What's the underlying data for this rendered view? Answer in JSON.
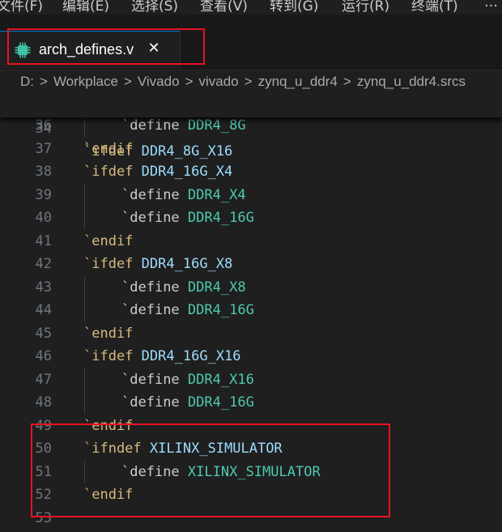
{
  "menu": {
    "items": [
      "文件(F)",
      "编辑(E)",
      "选择(S)",
      "查看(V)",
      "转到(G)",
      "运行(R)",
      "终端(T)"
    ],
    "more_label": "…"
  },
  "tab": {
    "label": "arch_defines.v",
    "close_label": "✕",
    "icon": "chip-icon",
    "icon_color": "#3fc1a6"
  },
  "breadcrumb": [
    "D:",
    "Workplace",
    "Vivado",
    "vivado",
    "zynq_u_ddr4",
    "zynq_u_ddr4.srcs"
  ],
  "breadcrumb_separator": ">",
  "sticky_line": {
    "num": "34",
    "directive": "`ifdef",
    "macro": "DDR4_8G_X16"
  },
  "code_lines": [
    {
      "num": "36",
      "tick": "`",
      "kw": "define",
      "macro": "DDR4_8G",
      "indent": true
    },
    {
      "num": "37",
      "tick": "",
      "kw": "`endif",
      "macro": "",
      "indent": false
    },
    {
      "num": "38",
      "tick": "",
      "kw": "`ifdef",
      "macro": "DDR4_16G_X4",
      "indent": false
    },
    {
      "num": "39",
      "tick": "`",
      "kw": "define",
      "macro": "DDR4_X4",
      "indent": true
    },
    {
      "num": "40",
      "tick": "`",
      "kw": "define",
      "macro": "DDR4_16G",
      "indent": true
    },
    {
      "num": "41",
      "tick": "",
      "kw": "`endif",
      "macro": "",
      "indent": false
    },
    {
      "num": "42",
      "tick": "",
      "kw": "`ifdef",
      "macro": "DDR4_16G_X8",
      "indent": false
    },
    {
      "num": "43",
      "tick": "`",
      "kw": "define",
      "macro": "DDR4_X8",
      "indent": true
    },
    {
      "num": "44",
      "tick": "`",
      "kw": "define",
      "macro": "DDR4_16G",
      "indent": true
    },
    {
      "num": "45",
      "tick": "",
      "kw": "`endif",
      "macro": "",
      "indent": false
    },
    {
      "num": "46",
      "tick": "",
      "kw": "`ifdef",
      "macro": "DDR4_16G_X16",
      "indent": false
    },
    {
      "num": "47",
      "tick": "`",
      "kw": "define",
      "macro": "DDR4_X16",
      "indent": true
    },
    {
      "num": "48",
      "tick": "`",
      "kw": "define",
      "macro": "DDR4_16G",
      "indent": true
    },
    {
      "num": "49",
      "tick": "",
      "kw": "`endif",
      "macro": "",
      "indent": false
    },
    {
      "num": "50",
      "tick": "",
      "kw": "`ifndef",
      "macro": "XILINX_SIMULATOR",
      "indent": false
    },
    {
      "num": "51",
      "tick": "`",
      "kw": "define",
      "macro": "XILINX_SIMULATOR",
      "indent": true
    },
    {
      "num": "52",
      "tick": "",
      "kw": "`endif",
      "macro": "",
      "indent": false
    },
    {
      "num": "53",
      "tick": "",
      "kw": "",
      "macro": "",
      "indent": false
    }
  ],
  "colors": {
    "editor_bg": "#1f1f1f",
    "directive": "#d7ba7d",
    "macro_ref": "#9cdcfe",
    "macro_defined": "#4ec9b0",
    "line_number": "#6e7681",
    "highlight_box": "#e81123"
  }
}
